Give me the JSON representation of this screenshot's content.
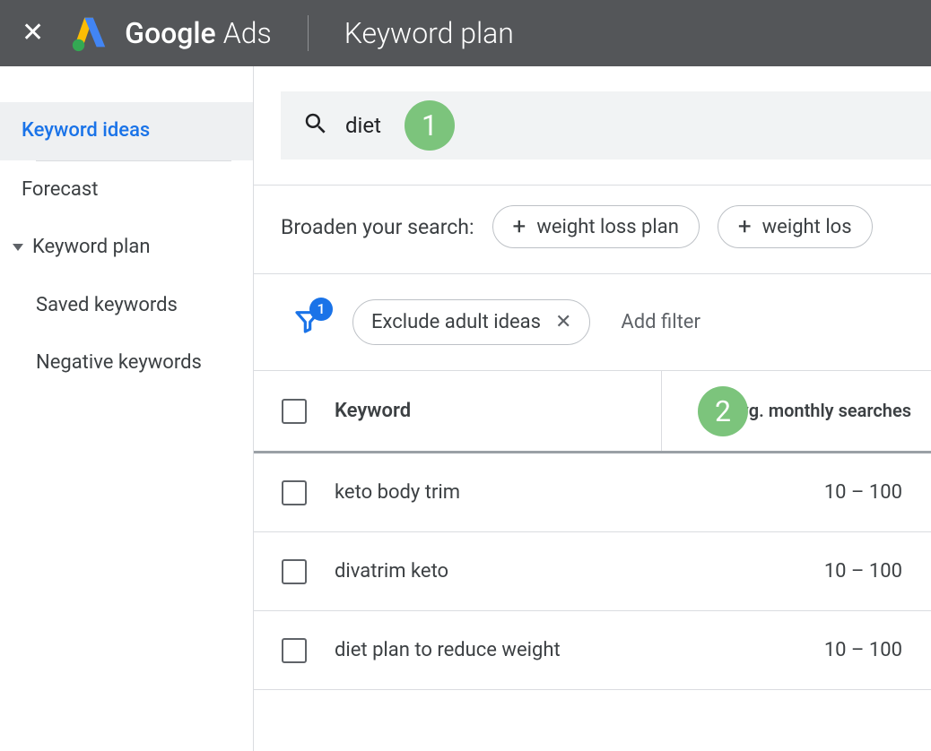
{
  "header": {
    "product_a": "Google",
    "product_b": "Ads",
    "page": "Keyword plan"
  },
  "sidebar": {
    "items": [
      {
        "label": "Keyword ideas",
        "active": true
      },
      {
        "label": "Forecast"
      },
      {
        "label": "Keyword plan",
        "collapsible": true
      },
      {
        "label": "Saved keywords"
      },
      {
        "label": "Negative keywords"
      }
    ]
  },
  "search": {
    "query": "diet"
  },
  "broaden": {
    "label": "Broaden your search:",
    "chips": [
      {
        "label": "weight loss plan"
      },
      {
        "label": "weight los"
      }
    ]
  },
  "filters": {
    "active_count": "1",
    "applied": {
      "label": "Exclude adult ideas"
    },
    "add_label": "Add filter"
  },
  "table": {
    "columns": {
      "keyword": "Keyword",
      "searches": "Avg. monthly searches"
    },
    "sort": {
      "column": "searches",
      "dir": "asc"
    },
    "rows": [
      {
        "keyword": "keto body trim",
        "searches": "10 – 100"
      },
      {
        "keyword": "divatrim keto",
        "searches": "10 – 100"
      },
      {
        "keyword": "diet plan to reduce weight",
        "searches": "10 – 100"
      }
    ]
  },
  "annotations": {
    "a1": "1",
    "a2": "2"
  }
}
